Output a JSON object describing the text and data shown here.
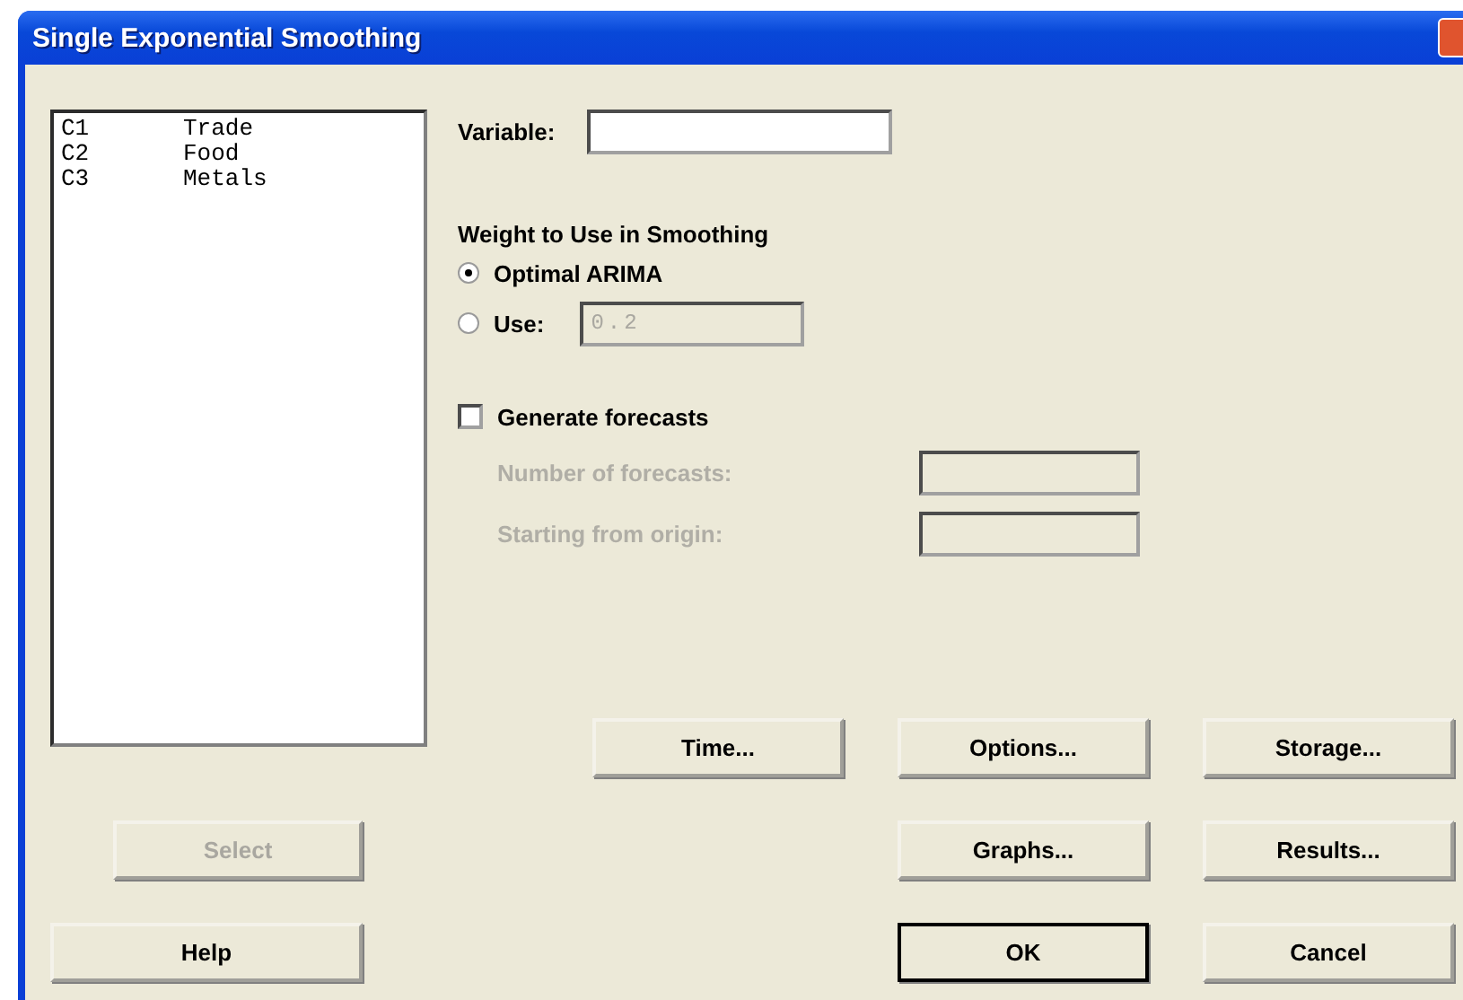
{
  "window": {
    "title": "Single Exponential Smoothing"
  },
  "columns_list": [
    {
      "column": "C1",
      "name": "Trade"
    },
    {
      "column": "C2",
      "name": "Food"
    },
    {
      "column": "C3",
      "name": "Metals"
    }
  ],
  "variable": {
    "label": "Variable:"
  },
  "weight": {
    "heading": "Weight to Use in Smoothing",
    "options": [
      {
        "label": "Optimal ARIMA",
        "selected": true
      },
      {
        "label": "Use:",
        "selected": false,
        "field": {
          "value": "0.2",
          "disabled": true
        }
      }
    ]
  },
  "forecasts": {
    "label": "Generate forecasts",
    "checked": false,
    "fields": [
      {
        "label": "Number of forecasts:",
        "disabled": true
      },
      {
        "label": "Starting from origin:",
        "disabled": true
      }
    ]
  },
  "buttons": [
    {
      "label": "Time...",
      "disabled": false,
      "default": false
    },
    {
      "label": "Options...",
      "disabled": false,
      "default": false
    },
    {
      "label": "Storage...",
      "disabled": false,
      "default": false
    },
    {
      "label": "Select",
      "disabled": true,
      "default": false
    },
    {
      "label": "Graphs...",
      "disabled": false,
      "default": false
    },
    {
      "label": "Results...",
      "disabled": false,
      "default": false
    },
    {
      "label": "Help",
      "disabled": false,
      "default": false
    },
    {
      "label": "OK",
      "disabled": false,
      "default": true
    },
    {
      "label": "Cancel",
      "disabled": false,
      "default": false
    }
  ]
}
